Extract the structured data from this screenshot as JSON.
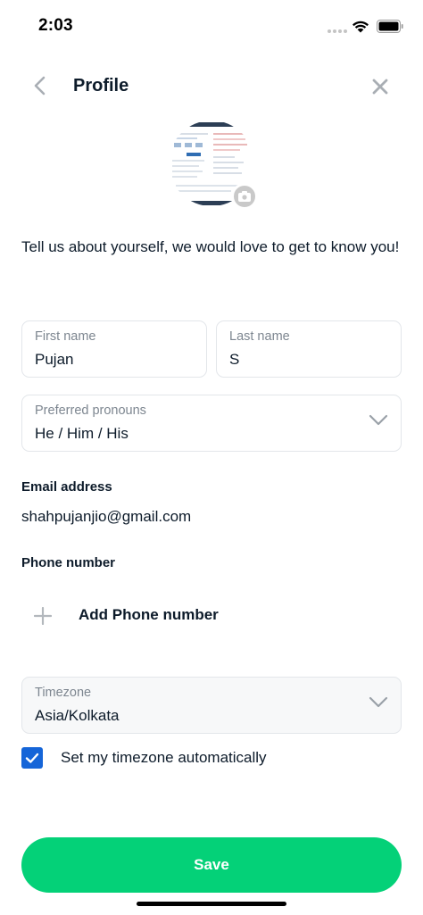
{
  "status_bar": {
    "time": "2:03"
  },
  "nav": {
    "title": "Profile"
  },
  "intro_text": "Tell us about yourself, we would love to get to know you!",
  "form": {
    "first_name": {
      "label": "First name",
      "value": "Pujan"
    },
    "last_name": {
      "label": "Last name",
      "value": "S"
    },
    "pronouns": {
      "label": "Preferred pronouns",
      "value": "He / Him / His"
    },
    "email": {
      "label": "Email address",
      "value": "shahpujanjio@gmail.com"
    },
    "phone": {
      "label": "Phone number",
      "add_label": "Add Phone number"
    },
    "timezone": {
      "label": "Timezone",
      "value": "Asia/Kolkata"
    },
    "auto_timezone": {
      "label": "Set my timezone automatically",
      "checked": true
    }
  },
  "save_label": "Save",
  "colors": {
    "accent": "#04d178",
    "checkbox": "#1565d8",
    "text": "#0d1b2a",
    "muted": "#7d8690"
  },
  "icons": [
    "back-chevron-icon",
    "close-icon",
    "camera-icon",
    "chevron-down-icon",
    "plus-icon",
    "checkmark-icon",
    "wifi-icon",
    "battery-icon",
    "signal-icon"
  ]
}
